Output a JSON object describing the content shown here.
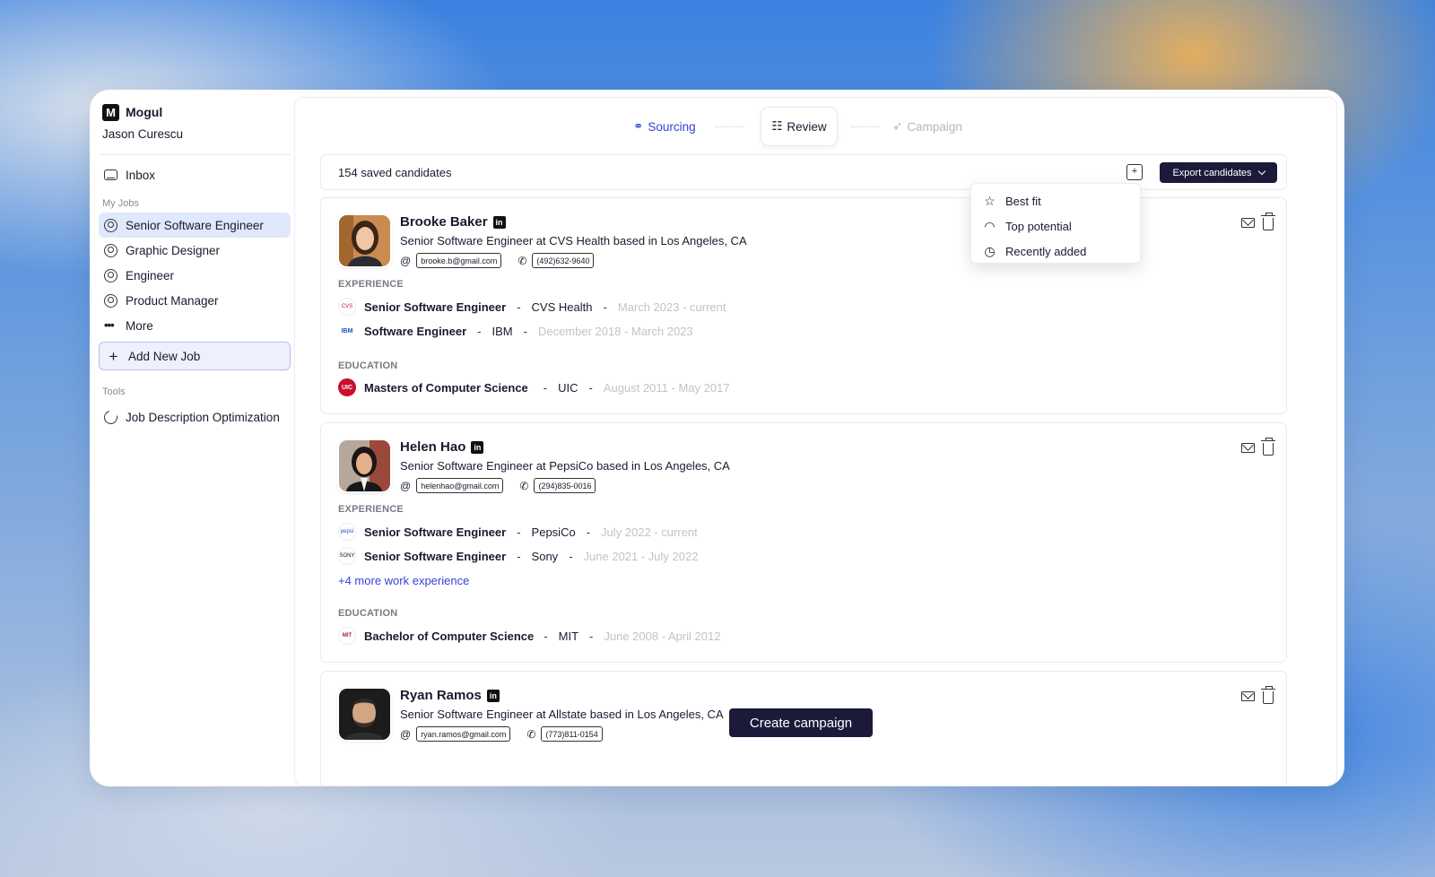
{
  "brand": {
    "name": "Mogul",
    "logo_letter": "M"
  },
  "user": {
    "name": "Jason Curescu"
  },
  "sidebar": {
    "inbox": "Inbox",
    "my_jobs_label": "My Jobs",
    "jobs": [
      {
        "label": "Senior Software Engineer",
        "active": true
      },
      {
        "label": "Graphic Designer",
        "active": false
      },
      {
        "label": "Engineer",
        "active": false
      },
      {
        "label": "Product Manager",
        "active": false
      }
    ],
    "more": "More",
    "add_job": "Add New Job",
    "tools_label": "Tools",
    "tools": [
      {
        "label": "Job Description Optimization"
      }
    ]
  },
  "steps": [
    {
      "label": "Sourcing",
      "state": "done"
    },
    {
      "label": "Review",
      "state": "current"
    },
    {
      "label": "Campaign",
      "state": "upcoming"
    }
  ],
  "toolbar": {
    "count_text": "154 saved candidates",
    "export_label": "Export candidates"
  },
  "sort_menu": {
    "items": [
      {
        "label": "Best fit",
        "icon": "star-icon"
      },
      {
        "label": "Top potential",
        "icon": "gauge-icon"
      },
      {
        "label": "Recently added",
        "icon": "clock-icon"
      }
    ]
  },
  "labels": {
    "experience": "EXPERIENCE",
    "education": "EDUCATION"
  },
  "candidates": [
    {
      "name": "Brooke Baker",
      "headline": "Senior Software Engineer at CVS Health based in Los Angeles, CA",
      "email": "brooke.b@gmail.com",
      "phone": "(492)632-9640",
      "experience": [
        {
          "role": "Senior Software Engineer",
          "company": "CVS Health",
          "dates": "March 2023 - current",
          "logo": "CVS"
        },
        {
          "role": "Software Engineer",
          "company": "IBM",
          "dates": "December 2018 - March 2023",
          "logo": "IBM"
        }
      ],
      "education": [
        {
          "degree": "Masters of Computer Science",
          "school": "UIC",
          "dates": "August 2011 - May 2017",
          "logo": "UIC"
        }
      ]
    },
    {
      "name": "Helen Hao",
      "headline": "Senior Software Engineer at PepsiCo based in Los Angeles, CA",
      "email": "helenhao@gmail.com",
      "phone": "(294)835-0016",
      "experience": [
        {
          "role": "Senior Software Engineer",
          "company": "PepsiCo",
          "dates": "July 2022 - current",
          "logo": "pepsi"
        },
        {
          "role": "Senior Software Engineer",
          "company": "Sony",
          "dates": "June 2021 - July 2022",
          "logo": "SONY"
        }
      ],
      "more_experience": "+4 more work experience",
      "education": [
        {
          "degree": "Bachelor of Computer Science",
          "school": "MIT",
          "dates": "June 2008 - April 2012",
          "logo": "MIT"
        }
      ]
    },
    {
      "name": "Ryan Ramos",
      "headline": "Senior Software Engineer at Allstate based in Los Angeles, CA",
      "email": "ryan.ramos@gmail.com",
      "phone": "(773)811-0154"
    }
  ],
  "create_campaign": "Create campaign"
}
